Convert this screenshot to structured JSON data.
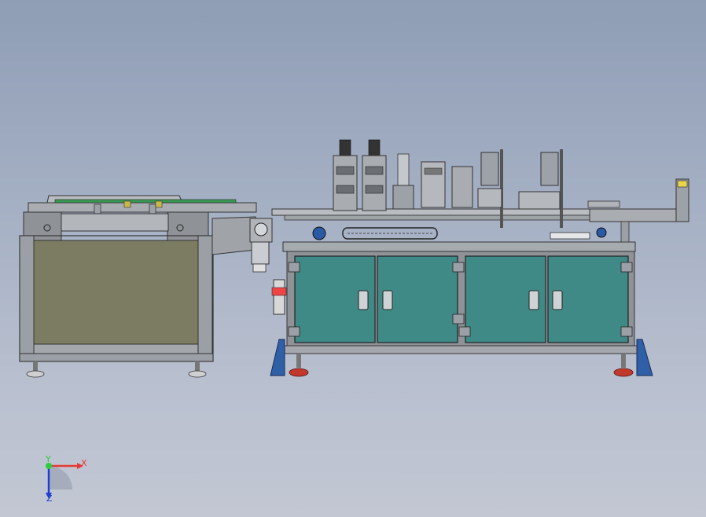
{
  "viewport": {
    "background_top": "#8f9db5",
    "background_bottom": "#c2c7d3"
  },
  "model": {
    "cabinet_color": "#3f8a86",
    "frame_color": "#9aa0a6",
    "panel_color": "#7c7c62",
    "foot_color": "#c0392b",
    "bracket_color": "#2f5fa6"
  },
  "triad": {
    "x_label": "X",
    "y_label": "Y",
    "z_label": "Z",
    "x_color": "#e53935",
    "y_color": "#2ecc40",
    "z_color": "#1e3fd0"
  }
}
